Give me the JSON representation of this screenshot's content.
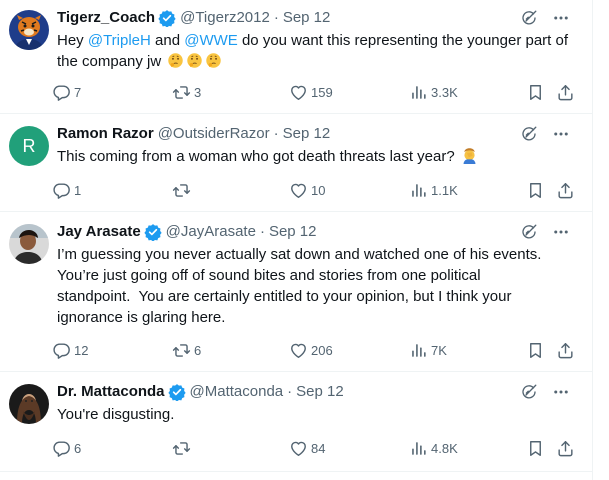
{
  "posts": [
    {
      "display_name": "Tigerz_Coach",
      "handle": "@Tigerz2012",
      "separator": "·",
      "date": "Sep 12",
      "text_parts": {
        "p1": "Hey ",
        "m1": "@TripleH",
        "p2": " and ",
        "m2": "@WWE",
        "p3": " do you want this representing the younger part of the company jw"
      },
      "emoji": [
        "thinking-face",
        "thinking-face",
        "thinking-face"
      ],
      "replies": "7",
      "reposts": "3",
      "likes": "159",
      "views": "3.3K",
      "verified": true,
      "avatar": "tiger-avatar"
    },
    {
      "display_name": "Ramon Razor",
      "handle": "@OutsiderRazor",
      "separator": "·",
      "date": "Sep 12",
      "text": "This coming from a woman who got death threats last year?",
      "emoji": [
        "man-facepalming"
      ],
      "replies": "1",
      "reposts": "",
      "likes": "10",
      "views": "1.1K",
      "verified": false,
      "avatar_letter": "R",
      "avatar_color": "#21a07a"
    },
    {
      "display_name": "Jay Arasate",
      "handle": "@JayArasate",
      "separator": "·",
      "date": "Sep 12",
      "lines": [
        "I’m guessing you never actually sat down and watched one of his events.",
        "You’re just going off of sound bites and stories from one political",
        "standpoint.  You are certainly entitled to your opinion, but I think your",
        "ignorance is glaring here."
      ],
      "replies": "12",
      "reposts": "6",
      "likes": "206",
      "views": "7K",
      "verified": true,
      "avatar": "photo-avatar"
    },
    {
      "display_name": "Dr. Mattaconda",
      "handle": "@Mattaconda",
      "separator": "·",
      "date": "Sep 12",
      "text": "You're disgusting.",
      "replies": "6",
      "reposts": "",
      "likes": "84",
      "views": "4.8K",
      "verified": true,
      "avatar": "photo-avatar"
    }
  ],
  "colors": {
    "accent": "#1d9bf0",
    "text": "#0f1419",
    "muted": "#536471",
    "divider": "#eff3f4"
  },
  "icons": {
    "reply": "reply-icon",
    "repost": "repost-icon",
    "like": "like-icon",
    "views": "views-icon",
    "bookmark": "bookmark-icon",
    "share": "share-icon",
    "grok": "grok-icon",
    "more": "more-icon",
    "verified": "verified-badge-icon"
  }
}
